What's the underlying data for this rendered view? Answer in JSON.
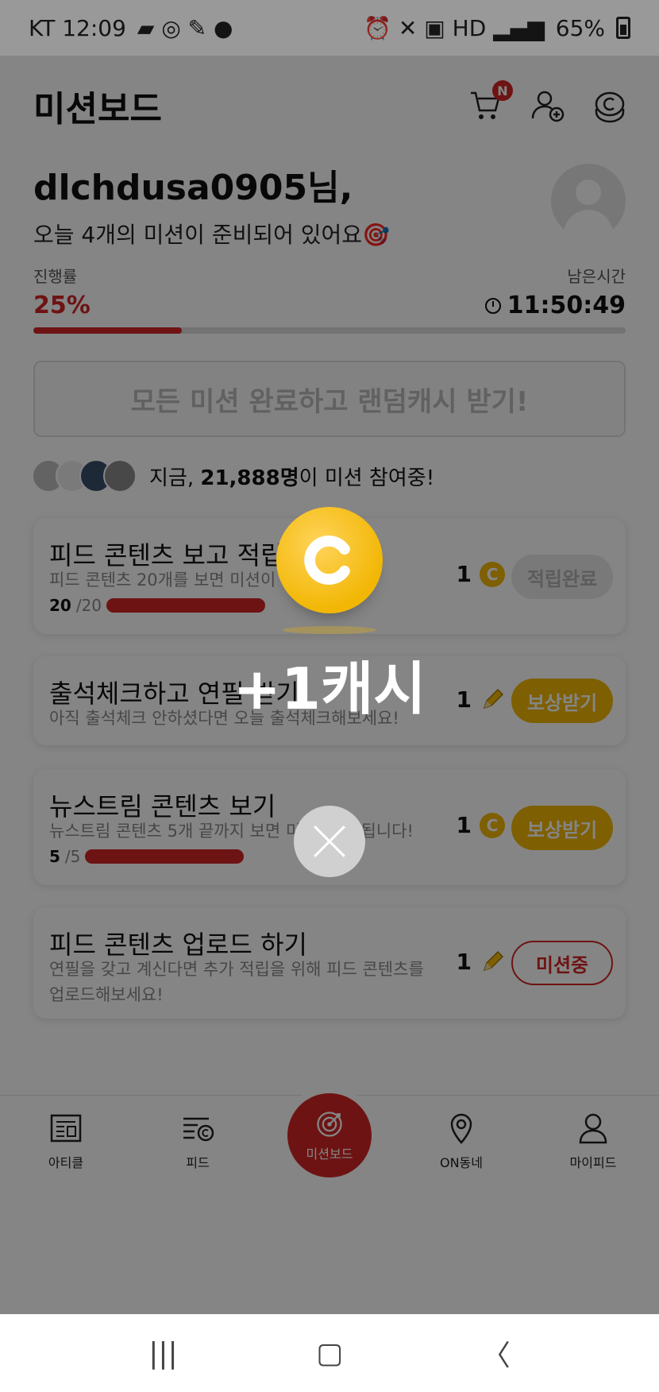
{
  "status_bar": {
    "carrier_time": "KT 12:09",
    "battery": "65%"
  },
  "header": {
    "title": "미션보드",
    "cart_badge": "N"
  },
  "greeting": {
    "user": "dlchdusa0905님,",
    "subtitle": "오늘 4개의 미션이 준비되어 있어요🎯"
  },
  "progress": {
    "label": "진행률",
    "percent_text": "25%",
    "percent_value": 0.25,
    "remaining_label": "남은시간",
    "remaining_time": "11:50:49"
  },
  "complete_all_button": "모든 미션 완료하고 랜덤캐시 받기!",
  "participants": {
    "prefix": "지금, ",
    "count": "21,888명",
    "suffix": "이 미션 참여중!"
  },
  "missions": [
    {
      "title": "피드 콘텐츠 보고 적립",
      "desc": "피드 콘텐츠 20개를 보면 미션이 완",
      "reward_count": "1",
      "reward_icon": "coin-icon",
      "progress_done": "20",
      "progress_total": "/20",
      "progress_value": 1.0,
      "action": "적립완료",
      "action_state": "done"
    },
    {
      "title": "출석체크하고 연필 받기",
      "desc": "아직 출석체크 안하셨다면 오늘 출석체크해보세요!",
      "reward_count": "1",
      "reward_icon": "pencil-icon",
      "action": "보상받기",
      "action_state": "claim"
    },
    {
      "title": "뉴스트림 콘텐츠 보기",
      "desc": "뉴스트림 콘텐츠 5개 끝까지 보면 미",
      "desc_tail": "료됩니다!",
      "reward_count": "1",
      "reward_icon": "coin-icon",
      "progress_done": "5",
      "progress_total": "/5",
      "progress_value": 1.0,
      "action": "보상받기",
      "action_state": "claim"
    },
    {
      "title": "피드 콘텐츠 업로드 하기",
      "desc_line1": "연필을 갖고 계신다면 추가 적립을 위해 피드 콘텐츠를",
      "desc_line2": "업로드해보세요!",
      "reward_count": "1",
      "reward_icon": "pencil-icon",
      "action": "미션중",
      "action_state": "ongoing"
    }
  ],
  "bottom_nav": [
    {
      "label": "아티클",
      "icon": "article-icon"
    },
    {
      "label": "피드",
      "icon": "feed-icon"
    },
    {
      "label": "미션보드",
      "icon": "target-icon"
    },
    {
      "label": "ON동네",
      "icon": "location-icon"
    },
    {
      "label": "마이피드",
      "icon": "profile-icon"
    }
  ],
  "popup": {
    "coin_letter": "C",
    "text": "+1캐시"
  },
  "colors": {
    "accent_red": "#d32626",
    "coin_yellow": "#f2b705"
  }
}
